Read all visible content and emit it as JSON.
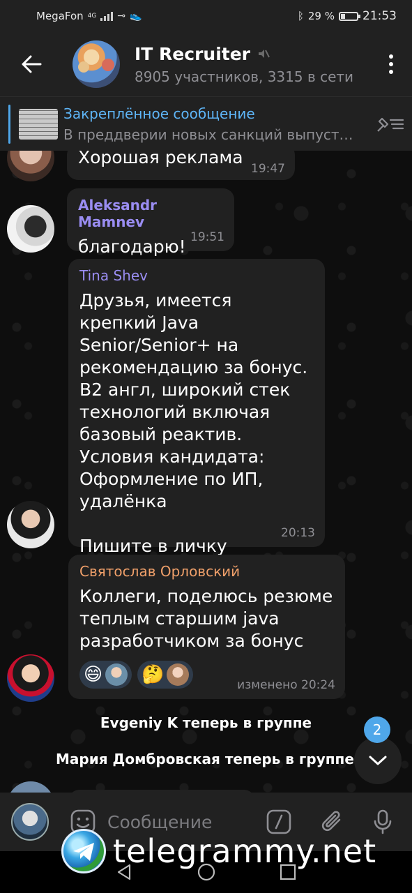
{
  "status_bar": {
    "carrier": "MegaFon",
    "network": "4G",
    "battery": "29 %",
    "battery_level": 0.29,
    "time": "21:53"
  },
  "header": {
    "title": "IT Recruiter",
    "subtitle": "8905 участников, 3315 в сети"
  },
  "pinned": {
    "title": "Закреплённое сообщение",
    "preview": "В преддверии новых санкций выпуст…"
  },
  "messages": [
    {
      "text": "Хорошая реклама",
      "time": "19:47"
    },
    {
      "sender": "Aleksandr Mamnev",
      "text": "благодарю!",
      "time": "19:51",
      "name_color": "#9a8df2"
    },
    {
      "sender": "Tina Shev",
      "text": "Друзья, имеется крепкий Java Senior/Senior+ на рекомендацию за бонус. B2 англ, широкий стек технологий включая базовый реактив.\nУсловия кандидата:\nОформление по ИП, удалёнка\n\nПишите в личку",
      "time": "20:13",
      "name_color": "#9a8df2"
    },
    {
      "sender": "Святослав Орловский",
      "text": "Коллеги, поделюсь резюме теплым старшим java разработчиком за бонус",
      "time": "изменено 20:24",
      "name_color": "#f0a06a",
      "reactions": [
        {
          "emoji": "😄"
        },
        {
          "emoji": "🤔"
        }
      ]
    }
  ],
  "service_messages": [
    "Evgeniy K теперь в группе",
    "Мария Домбровская теперь в группе"
  ],
  "unread_count": "2",
  "composer": {
    "placeholder": "Сообщение"
  },
  "watermark": "telegrammy.net",
  "colors": {
    "accent": "#4fa7ea",
    "bubble": "#212121",
    "background": "#0e0e0e"
  }
}
